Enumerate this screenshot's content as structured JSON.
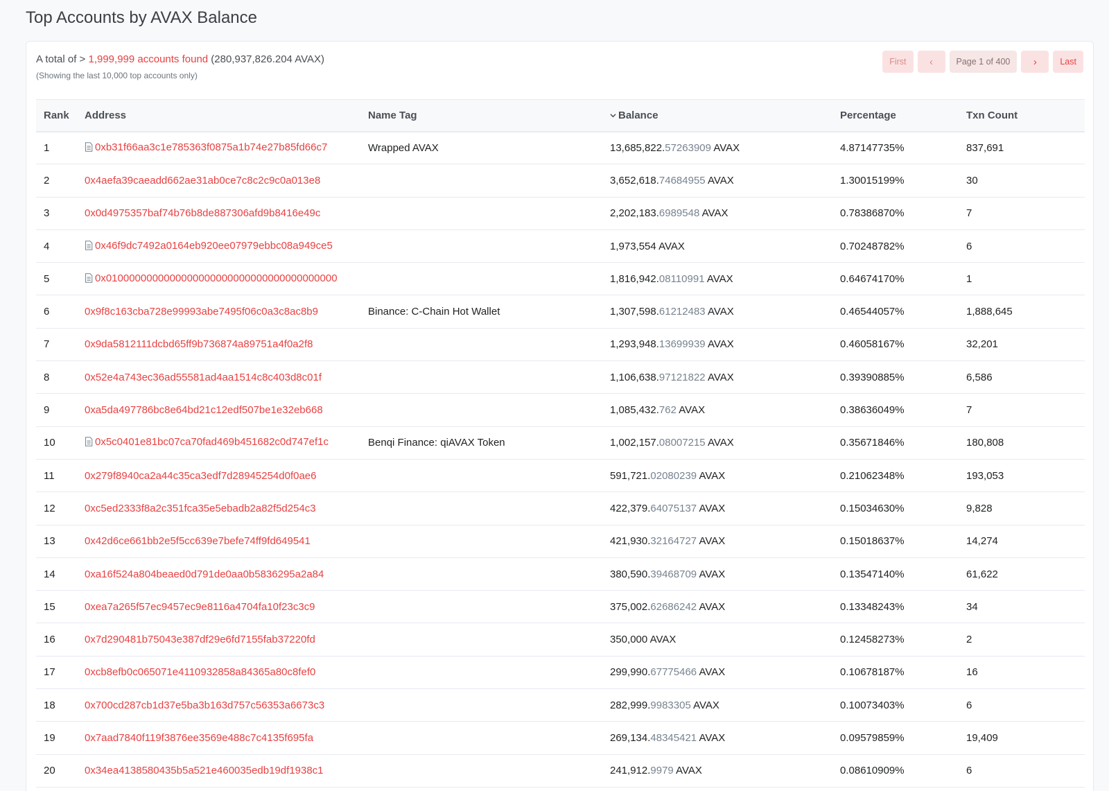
{
  "page": {
    "title": "Top Accounts by AVAX Balance"
  },
  "summary": {
    "prefix": "A total of",
    "gt": ">",
    "accounts_found": "1,999,999 accounts found",
    "total": "(280,937,826.204 AVAX)",
    "note": "(Showing the last 10,000 top accounts only)"
  },
  "pagination": {
    "first": "First",
    "prev": "‹",
    "page_info": "Page 1 of 400",
    "next": "›",
    "last": "Last"
  },
  "table": {
    "headers": {
      "rank": "Rank",
      "address": "Address",
      "name_tag": "Name Tag",
      "balance": "Balance",
      "percentage": "Percentage",
      "txn_count": "Txn Count"
    },
    "rows": [
      {
        "rank": "1",
        "address": "0xb31f66aa3c1e785363f0875a1b74e27b85fd66c7",
        "contract": true,
        "name_tag": "Wrapped AVAX",
        "balance_int": "13,685,822.",
        "balance_dec": "57263909",
        "unit": "AVAX",
        "percentage": "4.87147735%",
        "txn_count": "837,691"
      },
      {
        "rank": "2",
        "address": "0x4aefa39caeadd662ae31ab0ce7c8c2c9c0a013e8",
        "contract": false,
        "name_tag": "",
        "balance_int": "3,652,618.",
        "balance_dec": "74684955",
        "unit": "AVAX",
        "percentage": "1.30015199%",
        "txn_count": "30"
      },
      {
        "rank": "3",
        "address": "0x0d4975357baf74b76b8de887306afd9b8416e49c",
        "contract": false,
        "name_tag": "",
        "balance_int": "2,202,183.",
        "balance_dec": "6989548",
        "unit": "AVAX",
        "percentage": "0.78386870%",
        "txn_count": "7"
      },
      {
        "rank": "4",
        "address": "0x46f9dc7492a0164eb920ee07979ebbc08a949ce5",
        "contract": true,
        "name_tag": "",
        "balance_int": "1,973,554",
        "balance_dec": "",
        "unit": "AVAX",
        "percentage": "0.70248782%",
        "txn_count": "6"
      },
      {
        "rank": "5",
        "address": "0x0100000000000000000000000000000000000000",
        "contract": true,
        "name_tag": "",
        "balance_int": "1,816,942.",
        "balance_dec": "08110991",
        "unit": "AVAX",
        "percentage": "0.64674170%",
        "txn_count": "1"
      },
      {
        "rank": "6",
        "address": "0x9f8c163cba728e99993abe7495f06c0a3c8ac8b9",
        "contract": false,
        "name_tag": "Binance: C-Chain Hot Wallet",
        "balance_int": "1,307,598.",
        "balance_dec": "61212483",
        "unit": "AVAX",
        "percentage": "0.46544057%",
        "txn_count": "1,888,645"
      },
      {
        "rank": "7",
        "address": "0x9da5812111dcbd65ff9b736874a89751a4f0a2f8",
        "contract": false,
        "name_tag": "",
        "balance_int": "1,293,948.",
        "balance_dec": "13699939",
        "unit": "AVAX",
        "percentage": "0.46058167%",
        "txn_count": "32,201"
      },
      {
        "rank": "8",
        "address": "0x52e4a743ec36ad55581ad4aa1514c8c403d8c01f",
        "contract": false,
        "name_tag": "",
        "balance_int": "1,106,638.",
        "balance_dec": "97121822",
        "unit": "AVAX",
        "percentage": "0.39390885%",
        "txn_count": "6,586"
      },
      {
        "rank": "9",
        "address": "0xa5da497786bc8e64bd21c12edf507be1e32eb668",
        "contract": false,
        "name_tag": "",
        "balance_int": "1,085,432.",
        "balance_dec": "762",
        "unit": "AVAX",
        "percentage": "0.38636049%",
        "txn_count": "7"
      },
      {
        "rank": "10",
        "address": "0x5c0401e81bc07ca70fad469b451682c0d747ef1c",
        "contract": true,
        "name_tag": "Benqi Finance: qiAVAX Token",
        "balance_int": "1,002,157.",
        "balance_dec": "08007215",
        "unit": "AVAX",
        "percentage": "0.35671846%",
        "txn_count": "180,808"
      },
      {
        "rank": "11",
        "address": "0x279f8940ca2a44c35ca3edf7d28945254d0f0ae6",
        "contract": false,
        "name_tag": "",
        "balance_int": "591,721.",
        "balance_dec": "02080239",
        "unit": "AVAX",
        "percentage": "0.21062348%",
        "txn_count": "193,053"
      },
      {
        "rank": "12",
        "address": "0xc5ed2333f8a2c351fca35e5ebadb2a82f5d254c3",
        "contract": false,
        "name_tag": "",
        "balance_int": "422,379.",
        "balance_dec": "64075137",
        "unit": "AVAX",
        "percentage": "0.15034630%",
        "txn_count": "9,828"
      },
      {
        "rank": "13",
        "address": "0x42d6ce661bb2e5f5cc639e7befe74ff9fd649541",
        "contract": false,
        "name_tag": "",
        "balance_int": "421,930.",
        "balance_dec": "32164727",
        "unit": "AVAX",
        "percentage": "0.15018637%",
        "txn_count": "14,274"
      },
      {
        "rank": "14",
        "address": "0xa16f524a804beaed0d791de0aa0b5836295a2a84",
        "contract": false,
        "name_tag": "",
        "balance_int": "380,590.",
        "balance_dec": "39468709",
        "unit": "AVAX",
        "percentage": "0.13547140%",
        "txn_count": "61,622"
      },
      {
        "rank": "15",
        "address": "0xea7a265f57ec9457ec9e8116a4704fa10f23c3c9",
        "contract": false,
        "name_tag": "",
        "balance_int": "375,002.",
        "balance_dec": "62686242",
        "unit": "AVAX",
        "percentage": "0.13348243%",
        "txn_count": "34"
      },
      {
        "rank": "16",
        "address": "0x7d290481b75043e387df29e6fd7155fab37220fd",
        "contract": false,
        "name_tag": "",
        "balance_int": "350,000",
        "balance_dec": "",
        "unit": "AVAX",
        "percentage": "0.12458273%",
        "txn_count": "2"
      },
      {
        "rank": "17",
        "address": "0xcb8efb0c065071e4110932858a84365a80c8fef0",
        "contract": false,
        "name_tag": "",
        "balance_int": "299,990.",
        "balance_dec": "67775466",
        "unit": "AVAX",
        "percentage": "0.10678187%",
        "txn_count": "16"
      },
      {
        "rank": "18",
        "address": "0x700cd287cb1d37e5ba3b163d757c56353a6673c3",
        "contract": false,
        "name_tag": "",
        "balance_int": "282,999.",
        "balance_dec": "9983305",
        "unit": "AVAX",
        "percentage": "0.10073403%",
        "txn_count": "6"
      },
      {
        "rank": "19",
        "address": "0x7aad7840f119f3876ee3569e488c7c4135f695fa",
        "contract": false,
        "name_tag": "",
        "balance_int": "269,134.",
        "balance_dec": "48345421",
        "unit": "AVAX",
        "percentage": "0.09579859%",
        "txn_count": "19,409"
      },
      {
        "rank": "20",
        "address": "0x34ea4138580435b5a521e460035edb19df1938c1",
        "contract": false,
        "name_tag": "",
        "balance_int": "241,912.",
        "balance_dec": "9979",
        "unit": "AVAX",
        "percentage": "0.08610909%",
        "txn_count": "6"
      }
    ]
  },
  "colors": {
    "accent": "#e84142",
    "muted": "#77838f",
    "pager_bg": "#fbe2e2"
  },
  "icons": {
    "contract": "contract-file-icon",
    "sort": "chevron-down-icon"
  }
}
